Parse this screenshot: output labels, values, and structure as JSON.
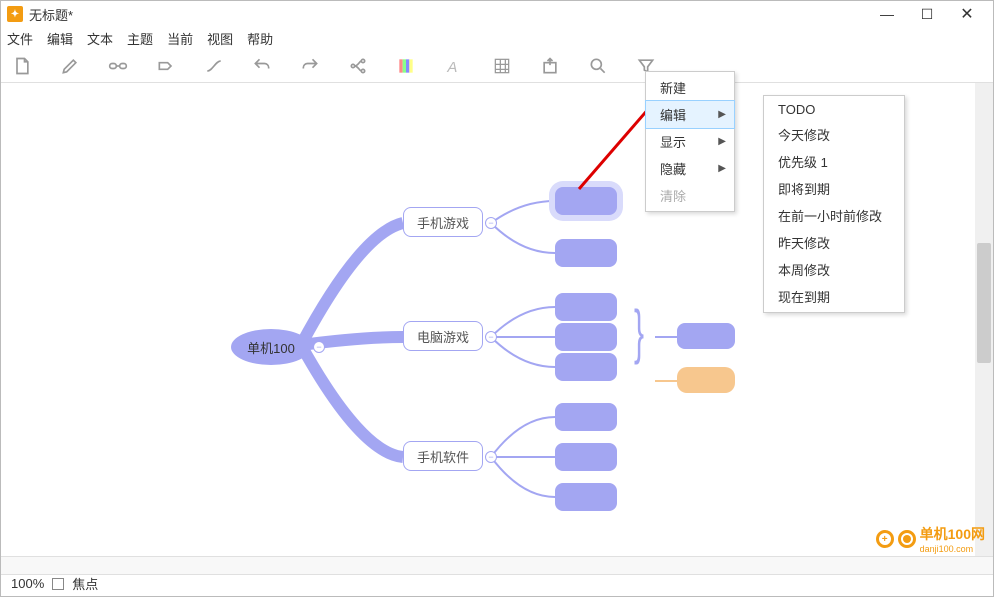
{
  "window": {
    "title": "无标题*"
  },
  "menubar": [
    "文件",
    "编辑",
    "文本",
    "主题",
    "当前",
    "视图",
    "帮助"
  ],
  "mindmap": {
    "root": "单机100",
    "b1": "手机游戏",
    "b2": "电脑游戏",
    "b3": "手机软件"
  },
  "context_main": [
    {
      "label": "新建",
      "arrow": false,
      "hi": false
    },
    {
      "label": "编辑",
      "arrow": true,
      "hi": true
    },
    {
      "label": "显示",
      "arrow": true,
      "hi": false
    },
    {
      "label": "隐藏",
      "arrow": true,
      "hi": false
    },
    {
      "label": "清除",
      "arrow": false,
      "hi": false,
      "dis": true
    }
  ],
  "context_sub": [
    "TODO",
    "今天修改",
    "优先级 1",
    "即将到期",
    "在前一小时前修改",
    "昨天修改",
    "本周修改",
    "现在到期"
  ],
  "status": {
    "zoom": "100%",
    "focus": "焦点"
  },
  "watermark": {
    "name": "单机100网",
    "url": "danji100.com"
  }
}
